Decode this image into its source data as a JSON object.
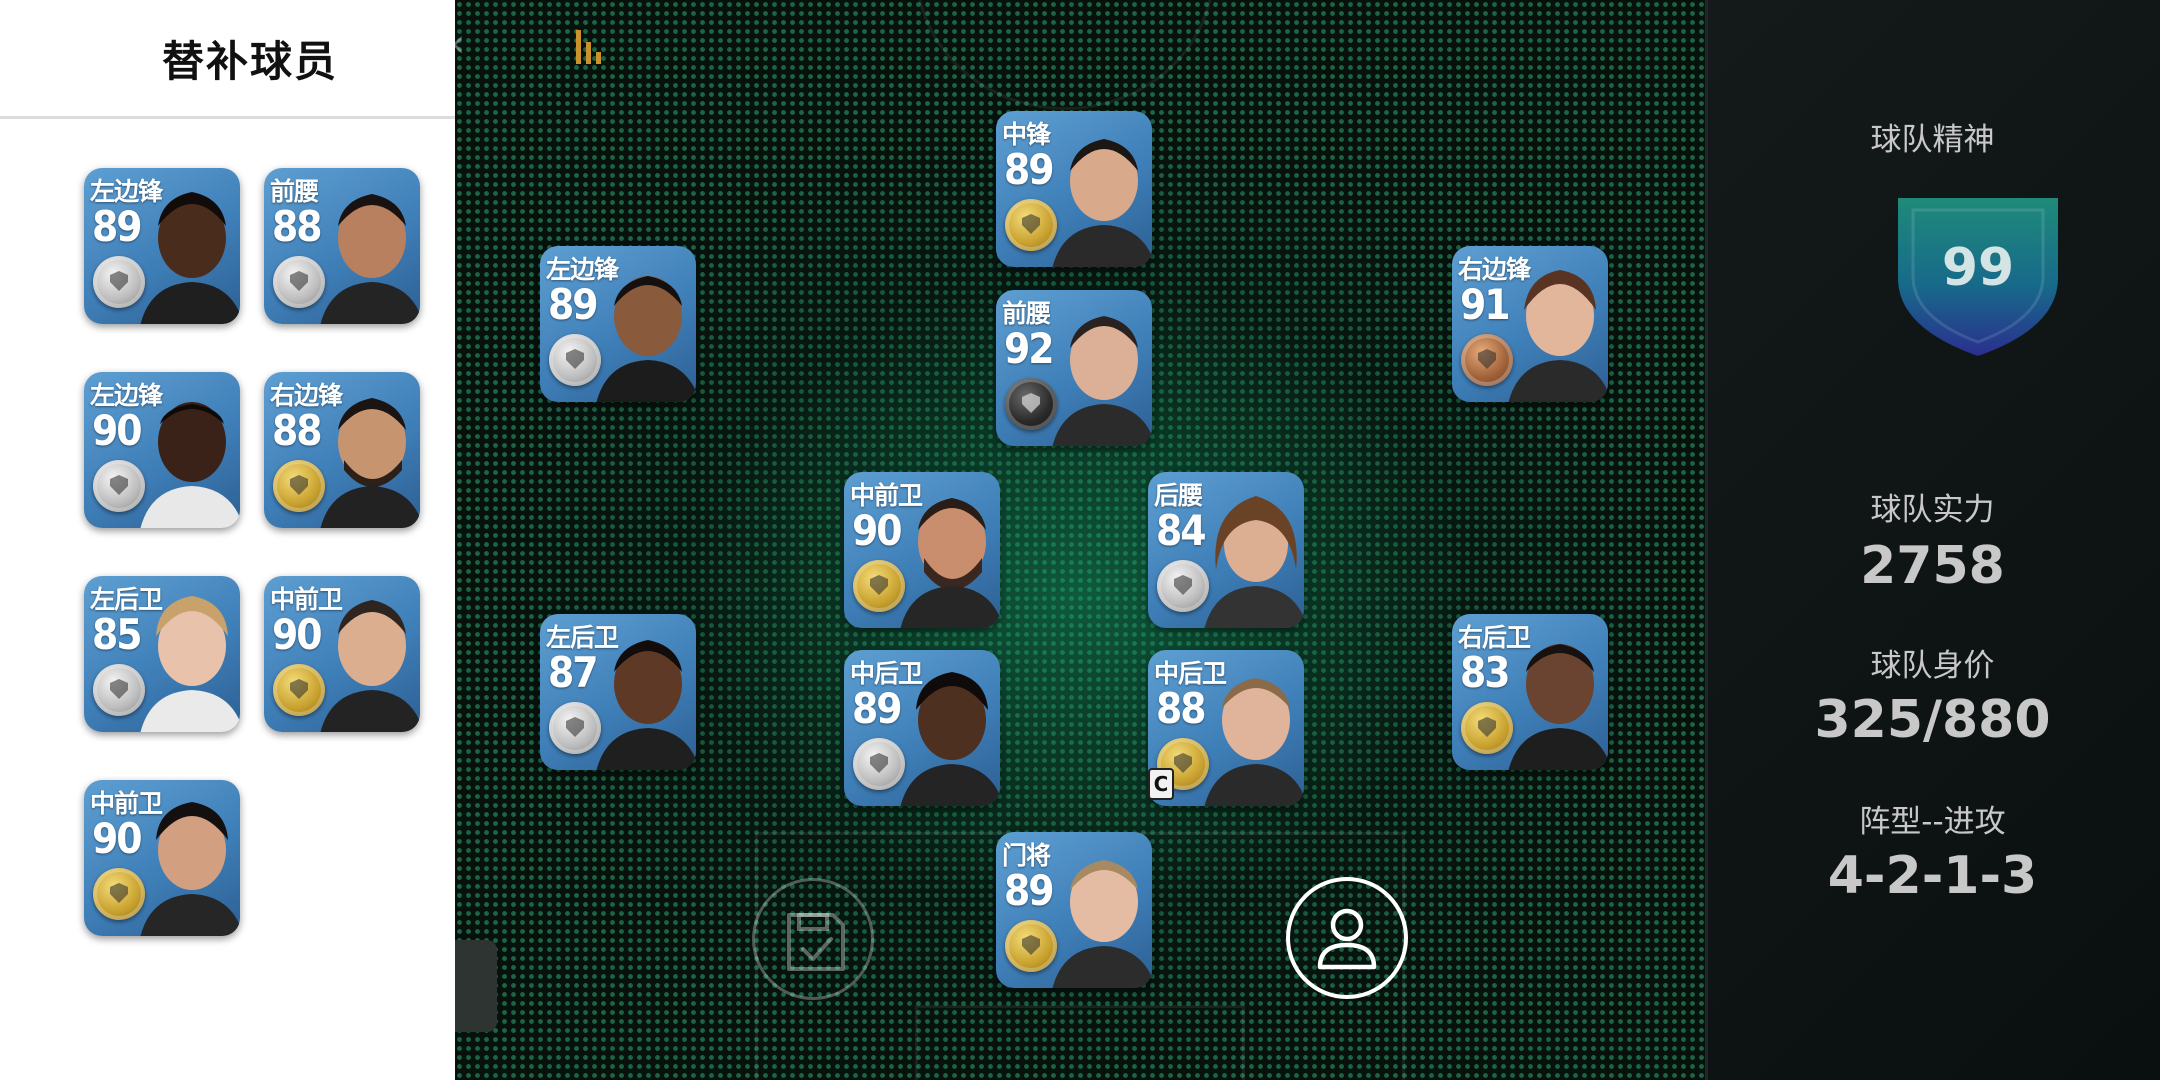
{
  "subs_panel": {
    "title": "替补球员",
    "players": [
      {
        "position": "左边锋",
        "rating": "89",
        "coin": "silver"
      },
      {
        "position": "前腰",
        "rating": "88",
        "coin": "silver"
      },
      {
        "position": "左边锋",
        "rating": "90",
        "coin": "silver"
      },
      {
        "position": "右边锋",
        "rating": "88",
        "coin": "gold"
      },
      {
        "position": "左后卫",
        "rating": "85",
        "coin": "silver"
      },
      {
        "position": "中前卫",
        "rating": "90",
        "coin": "gold"
      },
      {
        "position": "中前卫",
        "rating": "90",
        "coin": "gold"
      }
    ]
  },
  "lineup": {
    "players": [
      {
        "position": "中锋",
        "rating": "89",
        "coin": "gold"
      },
      {
        "position": "左边锋",
        "rating": "89",
        "coin": "silver"
      },
      {
        "position": "前腰",
        "rating": "92",
        "coin": "black"
      },
      {
        "position": "右边锋",
        "rating": "91",
        "coin": "bronze"
      },
      {
        "position": "中前卫",
        "rating": "90",
        "coin": "gold"
      },
      {
        "position": "后腰",
        "rating": "84",
        "coin": "silver"
      },
      {
        "position": "左后卫",
        "rating": "87",
        "coin": "silver"
      },
      {
        "position": "中后卫",
        "rating": "89",
        "coin": "silver"
      },
      {
        "position": "中后卫",
        "rating": "88",
        "coin": "gold"
      },
      {
        "position": "右后卫",
        "rating": "83",
        "coin": "gold"
      },
      {
        "position": "门将",
        "rating": "89",
        "coin": "gold"
      }
    ],
    "captain_label": "C",
    "back_label": "‹"
  },
  "team_info": {
    "spirit_label": "球队精神",
    "spirit_value": "99",
    "strength_label": "球队实力",
    "strength_value": "2758",
    "value_label": "球队身价",
    "value_value": "325/880",
    "formation_label": "阵型--进攻",
    "formation_value": "4-2-1-3"
  },
  "colors": {
    "pitch_dot": "#2daa6e",
    "card_blue": "#3f7fb8",
    "accent_orange": "#c9922a"
  },
  "icons": [
    "back-arrow-icon",
    "stats-bars-icon",
    "save-icon",
    "person-icon",
    "shield-icon",
    "coin-icon"
  ]
}
